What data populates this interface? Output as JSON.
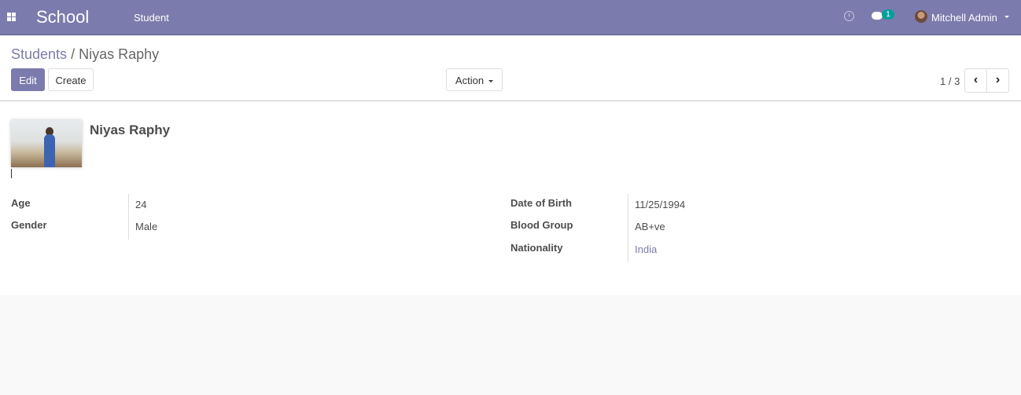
{
  "navbar": {
    "brand": "School",
    "menu": [
      "Student"
    ],
    "messages_badge": "1",
    "user": "Mitchell Admin",
    "accent": "#7c7bad"
  },
  "breadcrumb": {
    "parent": "Students",
    "separator": " / ",
    "current": "Niyas Raphy"
  },
  "buttons": {
    "edit": "Edit",
    "create": "Create",
    "action": "Action"
  },
  "pager": {
    "value": "1 / 3",
    "prev": "‹",
    "next": "›"
  },
  "record": {
    "name": "Niyas Raphy",
    "left_fields": [
      {
        "label": "Age",
        "value": "24"
      },
      {
        "label": "Gender",
        "value": "Male"
      }
    ],
    "right_fields": [
      {
        "label": "Date of Birth",
        "value": "11/25/1994"
      },
      {
        "label": "Blood Group",
        "value": "AB+ve"
      },
      {
        "label": "Nationality",
        "value": "India"
      }
    ]
  }
}
